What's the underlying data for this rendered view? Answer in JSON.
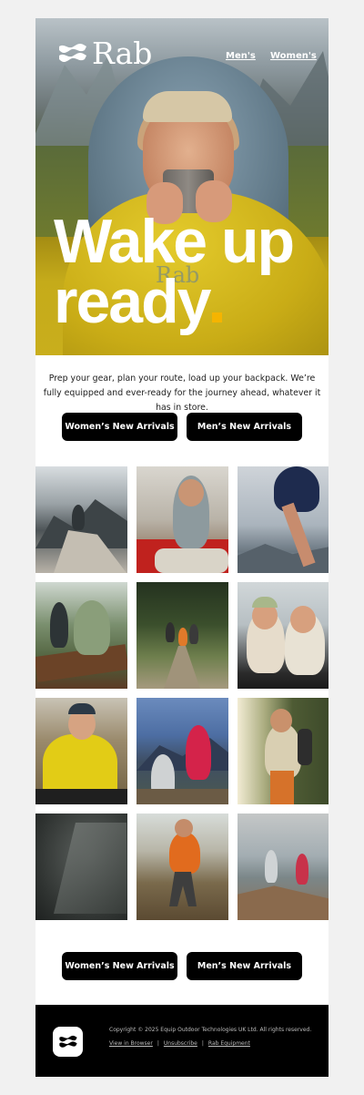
{
  "brand": {
    "name": "Rab",
    "icon": "rab-wave-logo-icon"
  },
  "nav": {
    "men": "Men's",
    "women": "Women's"
  },
  "hero": {
    "headline_line1": "Wake up",
    "headline_line2": "ready",
    "accent_color": "#f5b400",
    "bag_logo": "Rab"
  },
  "intro": {
    "text": "Prep your gear, plan your route, load up your backpack. We’re fully equipped and ever-ready for the journey ahead, whatever it has in store."
  },
  "buttons": {
    "women": "Women’s New Arrivals",
    "men": "Men’s New Arrivals"
  },
  "gallery": {
    "images": [
      "climber-on-rock-summit",
      "man-in-sleeping-bag-cap",
      "hiker-leaping-rocks",
      "hikers-climbing-log",
      "group-hiking-forest",
      "two-women-in-tent",
      "man-in-yellow-puffer",
      "two-hikers-mountain-trail",
      "hiker-with-backpack-forest",
      "waterproof-fabric-droplets",
      "runner-orange-jacket-trail",
      "two-runners-ridge"
    ]
  },
  "footer": {
    "copyright": "Copyright © 2025 Equip Outdoor Technologies UK Ltd. All rights reserved.",
    "view_in_browser": "View in Browser",
    "unsubscribe": "Unsubscribe",
    "rab_equipment": "Rab Equipment",
    "separator": "|"
  }
}
